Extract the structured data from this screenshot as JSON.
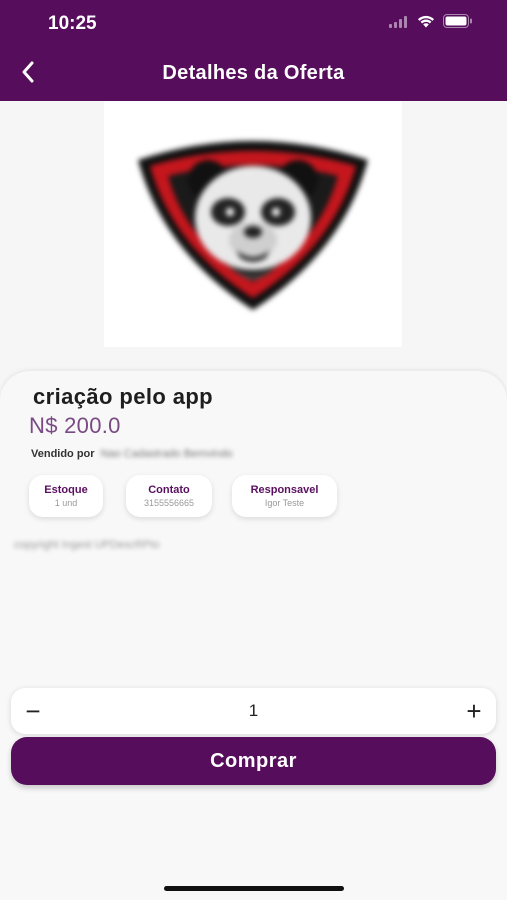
{
  "status_bar": {
    "time": "10:25",
    "icons": [
      "cellular-signal-icon",
      "wifi-icon",
      "battery-icon"
    ]
  },
  "nav": {
    "title": "Detalhes da Oferta",
    "back_icon": "chevron-left-icon"
  },
  "product": {
    "image_icon": "panda-mascot-logo",
    "title": "criação pelo app",
    "price": "N$ 200.0",
    "seller_label": "Vendido por",
    "seller_name": "Nao Cadastrado Bemvindo",
    "description": "copyright Ingest UPDescRPto"
  },
  "chips": [
    {
      "title": "Estoque",
      "value": "1 und"
    },
    {
      "title": "Contato",
      "value": "3155556665"
    },
    {
      "title": "Responsavel",
      "value": "Igor Teste"
    }
  ],
  "quantity": {
    "minus_label": "−",
    "value": "1",
    "plus_label": "+"
  },
  "actions": {
    "buy_label": "Comprar"
  },
  "colors": {
    "brand": "#560d5c",
    "price": "#7a4a85",
    "background": "#f6f6f6"
  }
}
